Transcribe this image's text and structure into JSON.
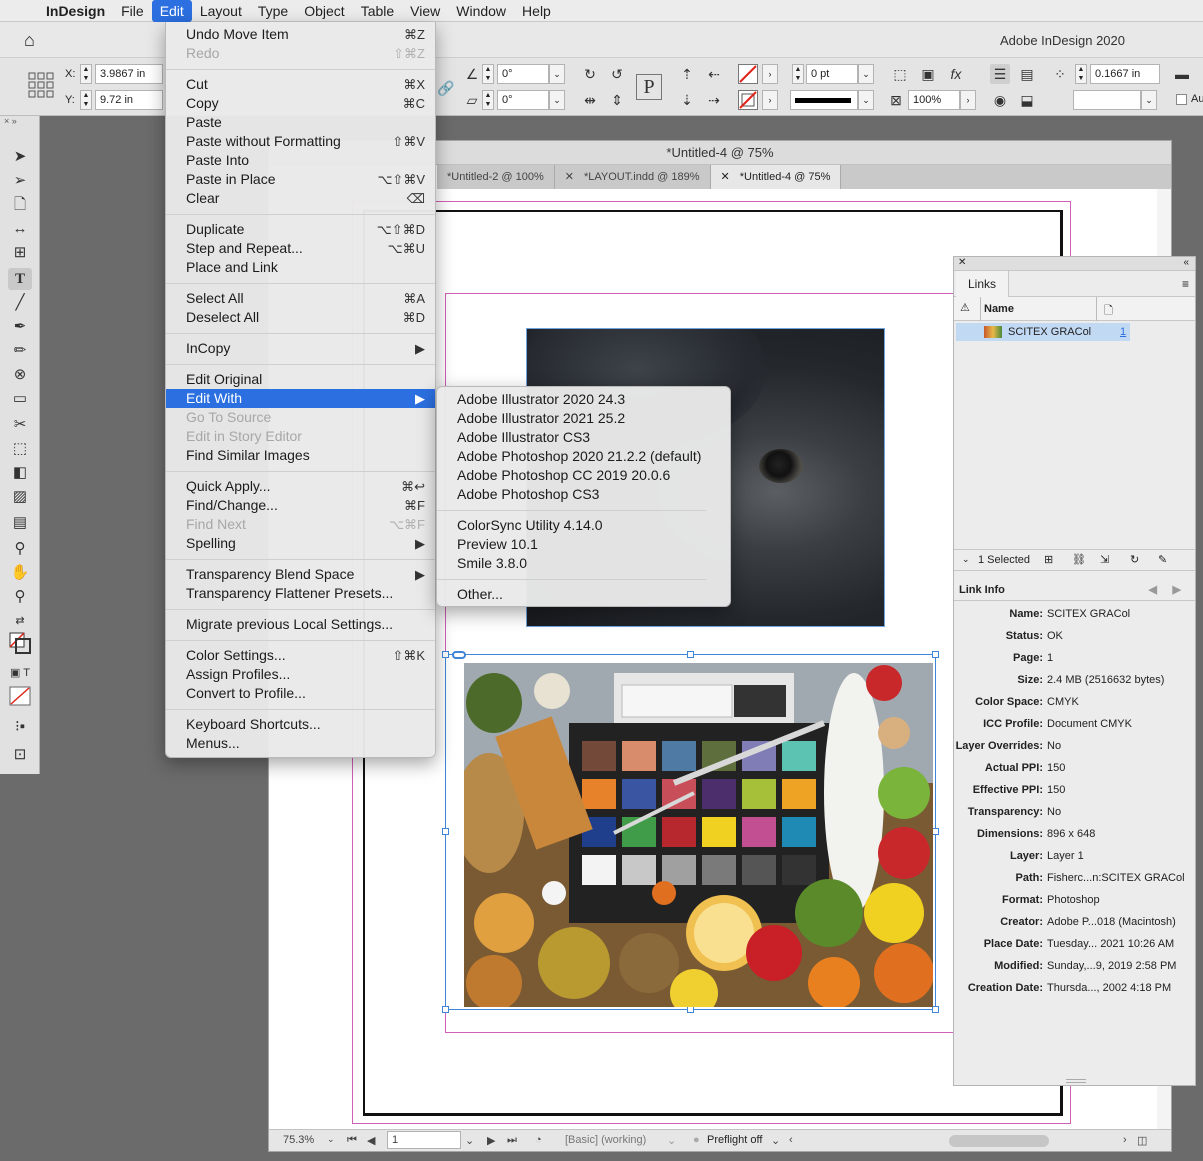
{
  "menubar": {
    "app": "InDesign",
    "items": [
      "File",
      "Edit",
      "Layout",
      "Type",
      "Object",
      "Table",
      "View",
      "Window",
      "Help"
    ]
  },
  "appbar": {
    "title": "Adobe InDesign 2020"
  },
  "control": {
    "x_label": "X:",
    "x": "3.9867 in",
    "y_label": "Y:",
    "y": "9.72 in",
    "rotate": "0°",
    "shear": "0°",
    "stroke_weight": "0 pt",
    "scale": "100%",
    "offset": "0.1667 in",
    "auto_fit": "Au"
  },
  "tools_header": "×  »",
  "edit_menu": {
    "groups": [
      [
        {
          "label": "Undo Move Item",
          "shortcut": "⌘Z"
        },
        {
          "label": "Redo",
          "shortcut": "⇧⌘Z",
          "disabled": true
        }
      ],
      [
        {
          "label": "Cut",
          "shortcut": "⌘X"
        },
        {
          "label": "Copy",
          "shortcut": "⌘C"
        },
        {
          "label": "Paste",
          "shortcut": ""
        },
        {
          "label": "Paste without Formatting",
          "shortcut": "⇧⌘V"
        },
        {
          "label": "Paste Into",
          "shortcut": ""
        },
        {
          "label": "Paste in Place",
          "shortcut": "⌥⇧⌘V"
        },
        {
          "label": "Clear",
          "shortcut": "⌫"
        }
      ],
      [
        {
          "label": "Duplicate",
          "shortcut": "⌥⇧⌘D"
        },
        {
          "label": "Step and Repeat...",
          "shortcut": "⌥⌘U"
        },
        {
          "label": "Place and Link",
          "shortcut": ""
        }
      ],
      [
        {
          "label": "Select All",
          "shortcut": "⌘A"
        },
        {
          "label": "Deselect All",
          "shortcut": "⌘D"
        }
      ],
      [
        {
          "label": "InCopy",
          "shortcut": "▶"
        }
      ],
      [
        {
          "label": "Edit Original",
          "shortcut": ""
        },
        {
          "label": "Edit With",
          "shortcut": "▶",
          "highlight": true
        },
        {
          "label": "Go To Source",
          "shortcut": "",
          "disabled": true
        },
        {
          "label": "Edit in Story Editor",
          "shortcut": "",
          "disabled": true
        },
        {
          "label": "Find Similar Images",
          "shortcut": ""
        }
      ],
      [
        {
          "label": "Quick Apply...",
          "shortcut": "⌘↩"
        },
        {
          "label": "Find/Change...",
          "shortcut": "⌘F"
        },
        {
          "label": "Find Next",
          "shortcut": "⌥⌘F",
          "disabled": true
        },
        {
          "label": "Spelling",
          "shortcut": "▶"
        }
      ],
      [
        {
          "label": "Transparency Blend Space",
          "shortcut": "▶"
        },
        {
          "label": "Transparency Flattener Presets...",
          "shortcut": ""
        }
      ],
      [
        {
          "label": "Migrate previous Local Settings...",
          "shortcut": ""
        }
      ],
      [
        {
          "label": "Color Settings...",
          "shortcut": "⇧⌘K"
        },
        {
          "label": "Assign Profiles...",
          "shortcut": ""
        },
        {
          "label": "Convert to Profile...",
          "shortcut": ""
        }
      ],
      [
        {
          "label": "Keyboard Shortcuts...",
          "shortcut": ""
        },
        {
          "label": "Menus...",
          "shortcut": ""
        }
      ]
    ]
  },
  "edit_with_submenu": {
    "groups": [
      [
        "Adobe Illustrator 2020 24.3",
        "Adobe Illustrator 2021 25.2",
        "Adobe Illustrator CS3",
        "Adobe Photoshop 2020 21.2.2 (default)",
        "Adobe Photoshop CC 2019 20.0.6",
        "Adobe Photoshop CS3"
      ],
      [
        "ColorSync Utility 4.14.0",
        "Preview 10.1",
        "Smile 3.8.0"
      ],
      [
        "Other..."
      ]
    ]
  },
  "document": {
    "title": "*Untitled-4 @ 75%",
    "tabs": [
      {
        "label": "*Untitled-2 @ 100%",
        "active": false
      },
      {
        "label": "*LAYOUT.indd @ 189%",
        "active": false
      },
      {
        "label": "*Untitled-4 @ 75%",
        "active": true
      }
    ],
    "status": {
      "zoom": "75.3%",
      "page": "1",
      "profile": "[Basic] (working)",
      "preflight": "Preflight off"
    }
  },
  "links_panel": {
    "tab": "Links",
    "col_name": "Name",
    "row_name": "SCITEX GRACol",
    "row_page": "1",
    "selected": "1 Selected",
    "info_title": "Link Info",
    "info": [
      {
        "k": "Name:",
        "v": "SCITEX GRACol"
      },
      {
        "k": "Status:",
        "v": "OK"
      },
      {
        "k": "Page:",
        "v": "1"
      },
      {
        "k": "Size:",
        "v": "2.4 MB (2516632 bytes)"
      },
      {
        "k": "Color Space:",
        "v": "CMYK"
      },
      {
        "k": "ICC Profile:",
        "v": "Document CMYK"
      },
      {
        "k": "Layer Overrides:",
        "v": "No"
      },
      {
        "k": "Actual PPI:",
        "v": "150"
      },
      {
        "k": "Effective PPI:",
        "v": "150"
      },
      {
        "k": "Transparency:",
        "v": "No"
      },
      {
        "k": "Dimensions:",
        "v": "896 x 648"
      },
      {
        "k": "Layer:",
        "v": "Layer 1"
      },
      {
        "k": "Path:",
        "v": "Fisherc...n:SCITEX GRACol"
      },
      {
        "k": "Format:",
        "v": "Photoshop"
      },
      {
        "k": "Creator:",
        "v": "Adobe P...018 (Macintosh)"
      },
      {
        "k": "Place Date:",
        "v": "Tuesday... 2021 10:26 AM"
      },
      {
        "k": "Modified:",
        "v": "Sunday,...9, 2019 2:58 PM"
      },
      {
        "k": "Creation Date:",
        "v": "Thursda..., 2002 4:18 PM"
      }
    ]
  },
  "colors": {
    "menu_highlight": "#2b6fe0",
    "margin_guide": "#d25fb6",
    "selection": "#3f86d8"
  }
}
